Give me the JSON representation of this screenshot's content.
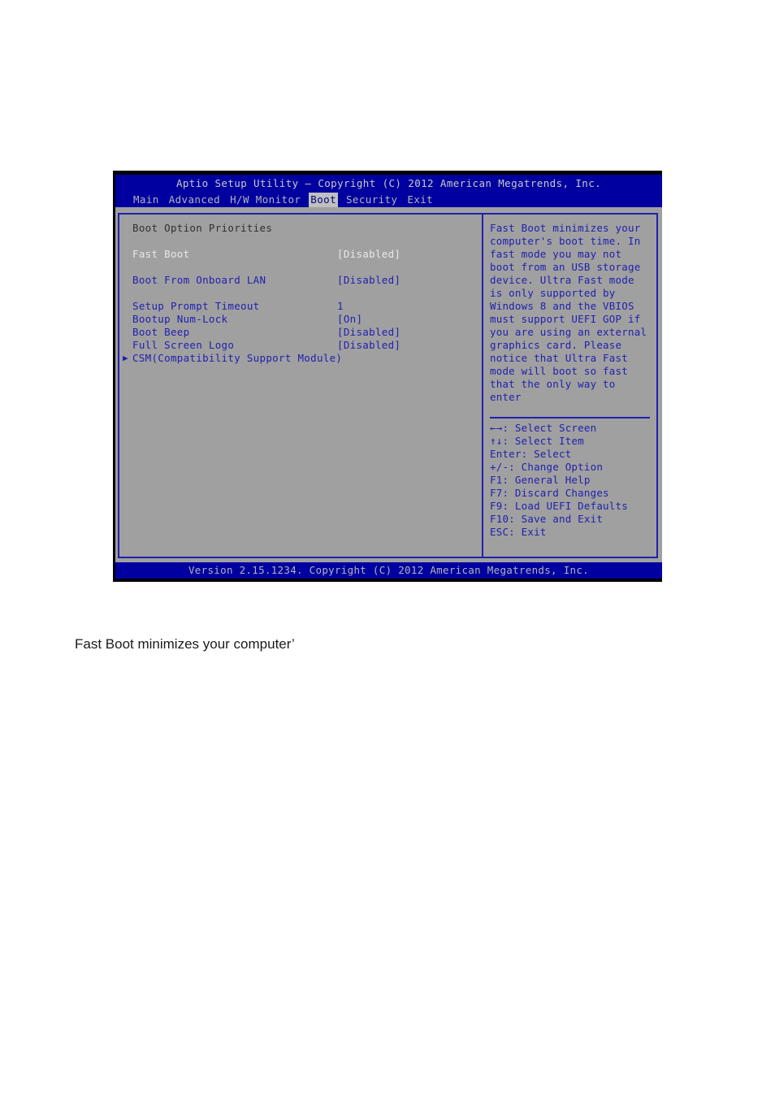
{
  "document": {
    "caption": "Fast Boot minimizes your computer’"
  },
  "bios": {
    "title": "Aptio Setup Utility – Copyright (C) 2012 American Megatrends, Inc.",
    "version_bar": "Version 2.15.1234. Copyright (C) 2012 American Megatrends, Inc.",
    "menu": {
      "tabs": [
        {
          "label": "Main",
          "active": false
        },
        {
          "label": "Advanced",
          "active": false
        },
        {
          "label": "H/W Monitor",
          "active": false
        },
        {
          "label": "Boot",
          "active": true
        },
        {
          "label": "Security",
          "active": false
        },
        {
          "label": "Exit",
          "active": false
        }
      ]
    },
    "left_panel": {
      "section_title": "Boot Option Priorities",
      "options": [
        {
          "label": "Fast Boot",
          "value": "[Disabled]",
          "selected": true,
          "submenu": false
        },
        {
          "label": "Boot From Onboard LAN",
          "value": "[Disabled]",
          "selected": false,
          "submenu": false
        },
        {
          "label": "Setup Prompt Timeout",
          "value": "1",
          "selected": false,
          "submenu": false
        },
        {
          "label": "Bootup Num-Lock",
          "value": "[On]",
          "selected": false,
          "submenu": false
        },
        {
          "label": "Boot Beep",
          "value": "[Disabled]",
          "selected": false,
          "submenu": false
        },
        {
          "label": "Full Screen Logo",
          "value": "[Disabled]",
          "selected": false,
          "submenu": false
        },
        {
          "label": "CSM(Compatibility Support Module)",
          "value": "",
          "selected": false,
          "submenu": true
        }
      ]
    },
    "right_panel": {
      "help_text": "Fast Boot minimizes your computer's boot time. In fast mode you may not boot from an USB storage device. Ultra Fast mode is only supported by Windows 8 and the VBIOS must support UEFI GOP if you are using an external graphics card. Please notice that Ultra Fast mode will boot so fast that the only way to enter",
      "keys": [
        "←→: Select Screen",
        "↑↓: Select Item",
        "Enter: Select",
        "+/-: Change Option",
        "F1: General Help",
        "F7: Discard Changes",
        "F9: Load UEFI Defaults",
        "F10: Save and Exit",
        "ESC: Exit"
      ]
    }
  },
  "colors": {
    "bios_blue": "#0000a0",
    "panel_gray": "#a0a0a0",
    "text_blue": "#2020b0",
    "selected_text": "#e8e8e8",
    "menu_text": "#b4b4b4",
    "section_title": "#303030"
  }
}
